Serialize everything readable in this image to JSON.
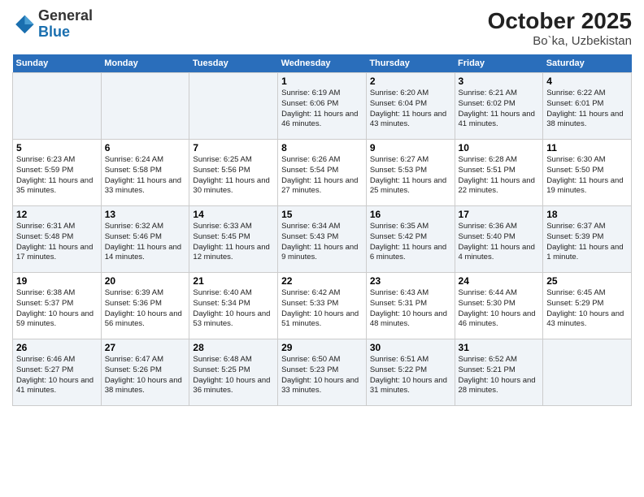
{
  "header": {
    "logo_line1": "General",
    "logo_line2": "Blue",
    "title": "October 2025",
    "subtitle": "Bo`ka, Uzbekistan"
  },
  "weekdays": [
    "Sunday",
    "Monday",
    "Tuesday",
    "Wednesday",
    "Thursday",
    "Friday",
    "Saturday"
  ],
  "weeks": [
    [
      {
        "day": "",
        "info": ""
      },
      {
        "day": "",
        "info": ""
      },
      {
        "day": "",
        "info": ""
      },
      {
        "day": "1",
        "info": "Sunrise: 6:19 AM\nSunset: 6:06 PM\nDaylight: 11 hours and 46 minutes."
      },
      {
        "day": "2",
        "info": "Sunrise: 6:20 AM\nSunset: 6:04 PM\nDaylight: 11 hours and 43 minutes."
      },
      {
        "day": "3",
        "info": "Sunrise: 6:21 AM\nSunset: 6:02 PM\nDaylight: 11 hours and 41 minutes."
      },
      {
        "day": "4",
        "info": "Sunrise: 6:22 AM\nSunset: 6:01 PM\nDaylight: 11 hours and 38 minutes."
      }
    ],
    [
      {
        "day": "5",
        "info": "Sunrise: 6:23 AM\nSunset: 5:59 PM\nDaylight: 11 hours and 35 minutes."
      },
      {
        "day": "6",
        "info": "Sunrise: 6:24 AM\nSunset: 5:58 PM\nDaylight: 11 hours and 33 minutes."
      },
      {
        "day": "7",
        "info": "Sunrise: 6:25 AM\nSunset: 5:56 PM\nDaylight: 11 hours and 30 minutes."
      },
      {
        "day": "8",
        "info": "Sunrise: 6:26 AM\nSunset: 5:54 PM\nDaylight: 11 hours and 27 minutes."
      },
      {
        "day": "9",
        "info": "Sunrise: 6:27 AM\nSunset: 5:53 PM\nDaylight: 11 hours and 25 minutes."
      },
      {
        "day": "10",
        "info": "Sunrise: 6:28 AM\nSunset: 5:51 PM\nDaylight: 11 hours and 22 minutes."
      },
      {
        "day": "11",
        "info": "Sunrise: 6:30 AM\nSunset: 5:50 PM\nDaylight: 11 hours and 19 minutes."
      }
    ],
    [
      {
        "day": "12",
        "info": "Sunrise: 6:31 AM\nSunset: 5:48 PM\nDaylight: 11 hours and 17 minutes."
      },
      {
        "day": "13",
        "info": "Sunrise: 6:32 AM\nSunset: 5:46 PM\nDaylight: 11 hours and 14 minutes."
      },
      {
        "day": "14",
        "info": "Sunrise: 6:33 AM\nSunset: 5:45 PM\nDaylight: 11 hours and 12 minutes."
      },
      {
        "day": "15",
        "info": "Sunrise: 6:34 AM\nSunset: 5:43 PM\nDaylight: 11 hours and 9 minutes."
      },
      {
        "day": "16",
        "info": "Sunrise: 6:35 AM\nSunset: 5:42 PM\nDaylight: 11 hours and 6 minutes."
      },
      {
        "day": "17",
        "info": "Sunrise: 6:36 AM\nSunset: 5:40 PM\nDaylight: 11 hours and 4 minutes."
      },
      {
        "day": "18",
        "info": "Sunrise: 6:37 AM\nSunset: 5:39 PM\nDaylight: 11 hours and 1 minute."
      }
    ],
    [
      {
        "day": "19",
        "info": "Sunrise: 6:38 AM\nSunset: 5:37 PM\nDaylight: 10 hours and 59 minutes."
      },
      {
        "day": "20",
        "info": "Sunrise: 6:39 AM\nSunset: 5:36 PM\nDaylight: 10 hours and 56 minutes."
      },
      {
        "day": "21",
        "info": "Sunrise: 6:40 AM\nSunset: 5:34 PM\nDaylight: 10 hours and 53 minutes."
      },
      {
        "day": "22",
        "info": "Sunrise: 6:42 AM\nSunset: 5:33 PM\nDaylight: 10 hours and 51 minutes."
      },
      {
        "day": "23",
        "info": "Sunrise: 6:43 AM\nSunset: 5:31 PM\nDaylight: 10 hours and 48 minutes."
      },
      {
        "day": "24",
        "info": "Sunrise: 6:44 AM\nSunset: 5:30 PM\nDaylight: 10 hours and 46 minutes."
      },
      {
        "day": "25",
        "info": "Sunrise: 6:45 AM\nSunset: 5:29 PM\nDaylight: 10 hours and 43 minutes."
      }
    ],
    [
      {
        "day": "26",
        "info": "Sunrise: 6:46 AM\nSunset: 5:27 PM\nDaylight: 10 hours and 41 minutes."
      },
      {
        "day": "27",
        "info": "Sunrise: 6:47 AM\nSunset: 5:26 PM\nDaylight: 10 hours and 38 minutes."
      },
      {
        "day": "28",
        "info": "Sunrise: 6:48 AM\nSunset: 5:25 PM\nDaylight: 10 hours and 36 minutes."
      },
      {
        "day": "29",
        "info": "Sunrise: 6:50 AM\nSunset: 5:23 PM\nDaylight: 10 hours and 33 minutes."
      },
      {
        "day": "30",
        "info": "Sunrise: 6:51 AM\nSunset: 5:22 PM\nDaylight: 10 hours and 31 minutes."
      },
      {
        "day": "31",
        "info": "Sunrise: 6:52 AM\nSunset: 5:21 PM\nDaylight: 10 hours and 28 minutes."
      },
      {
        "day": "",
        "info": ""
      }
    ]
  ]
}
